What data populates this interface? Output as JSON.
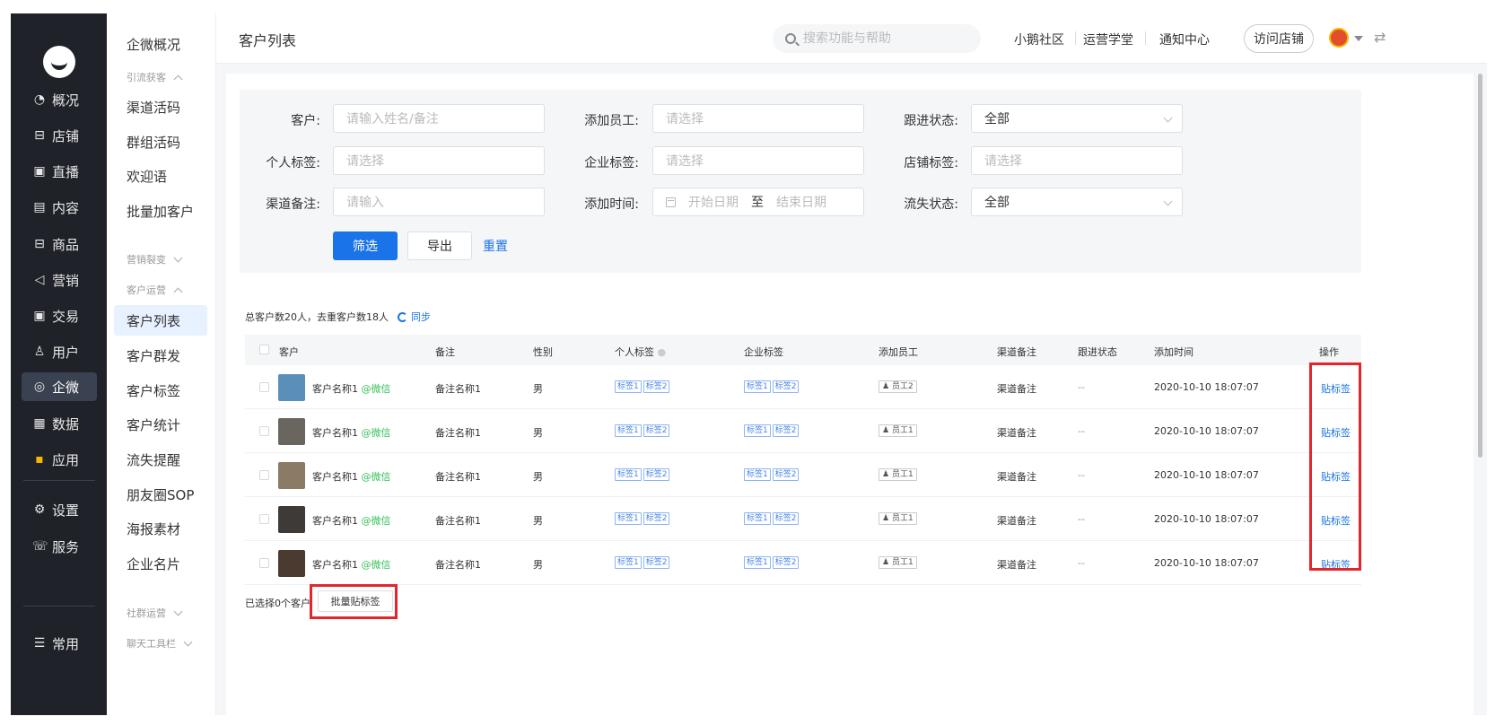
{
  "nav": {
    "items": [
      {
        "label": "概况",
        "icon": "pie-chart-icon",
        "glyph": "◔"
      },
      {
        "label": "店铺",
        "icon": "shop-icon",
        "glyph": "⊟"
      },
      {
        "label": "直播",
        "icon": "live-icon",
        "glyph": "▣"
      },
      {
        "label": "内容",
        "icon": "document-icon",
        "glyph": "▤"
      },
      {
        "label": "商品",
        "icon": "goods-icon",
        "glyph": "⊟"
      },
      {
        "label": "营销",
        "icon": "megaphone-icon",
        "glyph": "◁"
      },
      {
        "label": "交易",
        "icon": "trade-icon",
        "glyph": "▣"
      },
      {
        "label": "用户",
        "icon": "user-icon",
        "glyph": "♙"
      },
      {
        "label": "企微",
        "icon": "wecom-icon",
        "glyph": "◎"
      },
      {
        "label": "数据",
        "icon": "data-icon",
        "glyph": "▦"
      },
      {
        "label": "应用",
        "icon": "apps-icon",
        "glyph": "▪"
      },
      {
        "label": "设置",
        "icon": "gear-icon",
        "glyph": "⚙"
      },
      {
        "label": "服务",
        "icon": "service-icon",
        "glyph": "☏"
      },
      {
        "label": "常用",
        "icon": "list-icon",
        "glyph": "☰"
      }
    ]
  },
  "submenu": {
    "top": "企微概况",
    "group1": "引流获客",
    "g1_items": [
      "渠道活码",
      "群组活码",
      "欢迎语",
      "批量加客户"
    ],
    "group2": "营销裂变",
    "group3": "客户运营",
    "g3_items": [
      "客户列表",
      "客户群发",
      "客户标签",
      "客户统计",
      "流失提醒",
      "朋友圈SOP",
      "海报素材",
      "企业名片"
    ],
    "group4": "社群运营",
    "group5": "聊天工具栏"
  },
  "topbar": {
    "title": "客户列表",
    "search_placeholder": "搜索功能与帮助",
    "links": [
      "小鹅社区",
      "运营学堂",
      "通知中心"
    ],
    "visit": "访问店铺"
  },
  "filter": {
    "customer_label": "客户:",
    "customer_ph": "请输入姓名/备注",
    "staff_label": "添加员工:",
    "staff_ph": "请选择",
    "follow_label": "跟进状态:",
    "follow_value": "全部",
    "ptag_label": "个人标签:",
    "ptag_ph": "请选择",
    "etag_label": "企业标签:",
    "etag_ph": "请选择",
    "stag_label": "店铺标签:",
    "stag_ph": "请选择",
    "channel_label": "渠道备注:",
    "channel_ph": "请输入",
    "time_label": "添加时间:",
    "start_ph": "开始日期",
    "to": "至",
    "end_ph": "结束日期",
    "lost_label": "流失状态:",
    "lost_value": "全部",
    "btn_filter": "筛选",
    "btn_export": "导出",
    "btn_reset": "重置"
  },
  "summary": {
    "text": "总客户数20人，去重客户数18人",
    "sync": "同步"
  },
  "table": {
    "headers": [
      "客户",
      "备注",
      "性别",
      "个人标签",
      "企业标签",
      "添加员工",
      "渠道备注",
      "跟进状态",
      "添加时间",
      "操作"
    ],
    "wx_label": "@微信",
    "rows": [
      {
        "name": "客户名称1",
        "remark": "备注名称1",
        "gender": "男",
        "ptags": [
          "标签1",
          "标签2"
        ],
        "etags": [
          "标签1",
          "标签2"
        ],
        "staff": "员工2",
        "channel": "渠道备注",
        "follow": "--",
        "time": "2020-10-10 18:07:07",
        "op": "贴标签",
        "avatar_color": "#5b8fb9"
      },
      {
        "name": "客户名称1",
        "remark": "备注名称1",
        "gender": "男",
        "ptags": [
          "标签1",
          "标签2"
        ],
        "etags": [
          "标签1",
          "标签2"
        ],
        "staff": "员工1",
        "channel": "渠道备注",
        "follow": "--",
        "time": "2020-10-10 18:07:07",
        "op": "贴标签",
        "avatar_color": "#6b6560"
      },
      {
        "name": "客户名称1",
        "remark": "备注名称1",
        "gender": "男",
        "ptags": [
          "标签1",
          "标签2"
        ],
        "etags": [
          "标签1",
          "标签2"
        ],
        "staff": "员工1",
        "channel": "渠道备注",
        "follow": "--",
        "time": "2020-10-10 18:07:07",
        "op": "贴标签",
        "avatar_color": "#8a7a66"
      },
      {
        "name": "客户名称1",
        "remark": "备注名称1",
        "gender": "男",
        "ptags": [
          "标签1",
          "标签2"
        ],
        "etags": [
          "标签1",
          "标签2"
        ],
        "staff": "员工1",
        "channel": "渠道备注",
        "follow": "--",
        "time": "2020-10-10 18:07:07",
        "op": "贴标签",
        "avatar_color": "#3d3a37"
      },
      {
        "name": "客户名称1",
        "remark": "备注名称1",
        "gender": "男",
        "ptags": [
          "标签1",
          "标签2"
        ],
        "etags": [
          "标签1",
          "标签2"
        ],
        "staff": "员工1",
        "channel": "渠道备注",
        "follow": "--",
        "time": "2020-10-10 18:07:07",
        "op": "贴标签",
        "avatar_color": "#4a3a30"
      }
    ]
  },
  "footer": {
    "selected": "已选择0个客户",
    "batch": "批量贴标签"
  },
  "colors": {
    "primary": "#1a73e8",
    "nav_bg": "#1f2329",
    "highlight": "#e3262d",
    "wechat": "#36c05b"
  }
}
